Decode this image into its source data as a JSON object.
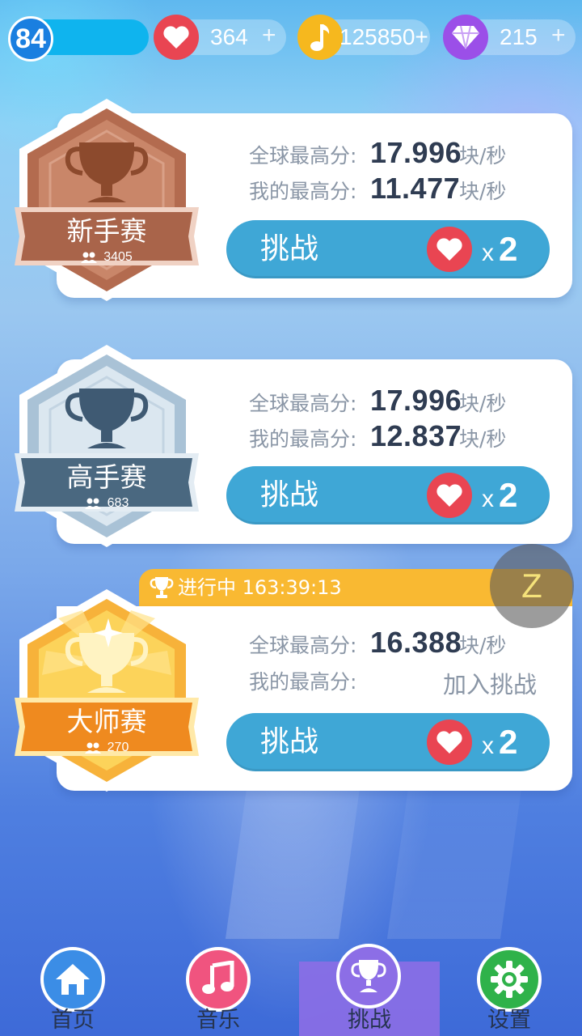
{
  "status_bar": {
    "level": "84",
    "hearts": "364",
    "notes": "125850+",
    "gems": "215",
    "plus": "+"
  },
  "tournaments": [
    {
      "name": "新手赛",
      "participants": "3405",
      "global_label": "全球最高分:",
      "global_score": "17.996",
      "my_label": "我的最高分:",
      "my_score": "11.477",
      "unit": "块/秒",
      "button_label": "挑战",
      "cost_x": "x",
      "cost_n": "2",
      "badge_color": "#a9644a"
    },
    {
      "name": "高手赛",
      "participants": "683",
      "global_label": "全球最高分:",
      "global_score": "17.996",
      "my_label": "我的最高分:",
      "my_score": "12.837",
      "unit": "块/秒",
      "button_label": "挑战",
      "cost_x": "x",
      "cost_n": "2",
      "badge_color": "#4a6880"
    },
    {
      "name": "大师赛",
      "participants": "270",
      "global_label": "全球最高分:",
      "global_score": "16.388",
      "my_label": "我的最高分:",
      "my_join": "加入挑战",
      "unit": "块/秒",
      "button_label": "挑战",
      "cost_x": "x",
      "cost_n": "2",
      "badge_color": "#f5a623",
      "in_progress": "进行中 163:39:13"
    }
  ],
  "z_button": "Z",
  "bottom_nav": [
    {
      "label": "首页",
      "icon": "home-icon",
      "color": "#3b8de6"
    },
    {
      "label": "音乐",
      "icon": "music-note-icon",
      "color": "#f0547f"
    },
    {
      "label": "挑战",
      "icon": "trophy-icon",
      "color": "#8c6ee6",
      "active": true
    },
    {
      "label": "设置",
      "icon": "gear-icon",
      "color": "#2fb24a"
    }
  ]
}
